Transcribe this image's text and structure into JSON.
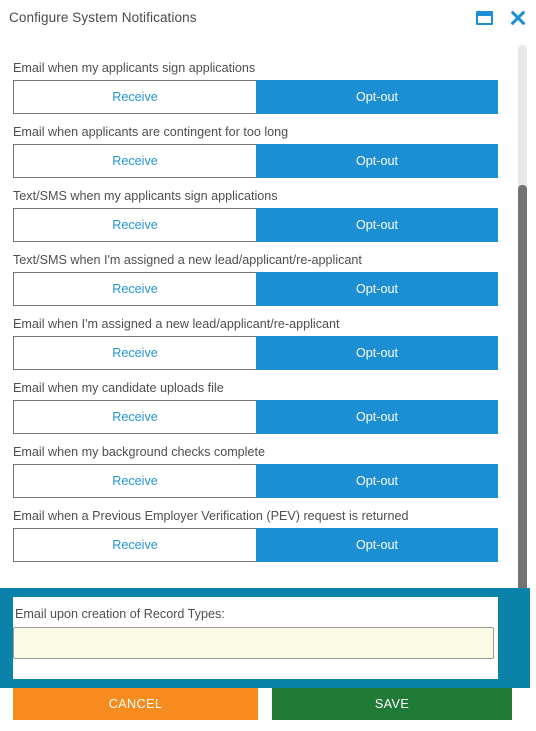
{
  "window": {
    "title": "Configure System Notifications",
    "maximize_icon": "window-restore-icon",
    "close_icon": "close-icon"
  },
  "colors": {
    "accent_blue": "#1c8fd4",
    "link_blue": "#2196d8",
    "teal_panel": "#0b82aa",
    "cancel_orange": "#f78b1e",
    "save_green": "#1f7a35",
    "input_yellow": "#fbfbe5",
    "scrollbar_thumb": "#737373",
    "scrollbar_track": "#e8e8e8"
  },
  "toggle": {
    "receive_label": "Receive",
    "optout_label": "Opt-out"
  },
  "notifications": [
    {
      "label": "",
      "receive_label": "Receive",
      "optout_label": "Opt-out",
      "selected": "Opt-out"
    },
    {
      "label": "Email when my applicants sign applications",
      "receive_label": "Receive",
      "optout_label": "Opt-out",
      "selected": "Opt-out"
    },
    {
      "label": "Email when applicants are contingent for too long",
      "receive_label": "Receive",
      "optout_label": "Opt-out",
      "selected": "Opt-out"
    },
    {
      "label": "Text/SMS when my applicants sign applications",
      "receive_label": "Receive",
      "optout_label": "Opt-out",
      "selected": "Opt-out"
    },
    {
      "label": "Text/SMS when I'm assigned a new lead/applicant/re-applicant",
      "receive_label": "Receive",
      "optout_label": "Opt-out",
      "selected": "Opt-out"
    },
    {
      "label": "Email when I'm assigned a new lead/applicant/re-applicant",
      "receive_label": "Receive",
      "optout_label": "Opt-out",
      "selected": "Opt-out"
    },
    {
      "label": "Email when my candidate uploads file",
      "receive_label": "Receive",
      "optout_label": "Opt-out",
      "selected": "Opt-out"
    },
    {
      "label": "Email when my background checks complete",
      "receive_label": "Receive",
      "optout_label": "Opt-out",
      "selected": "Opt-out"
    },
    {
      "label": "Email when a Previous Employer Verification (PEV) request is returned",
      "receive_label": "Receive",
      "optout_label": "Opt-out",
      "selected": "Opt-out"
    }
  ],
  "record_types": {
    "label": "Email upon creation of Record Types:",
    "value": "",
    "placeholder": ""
  },
  "footer": {
    "cancel_label": "CANCEL",
    "save_label": "SAVE"
  }
}
